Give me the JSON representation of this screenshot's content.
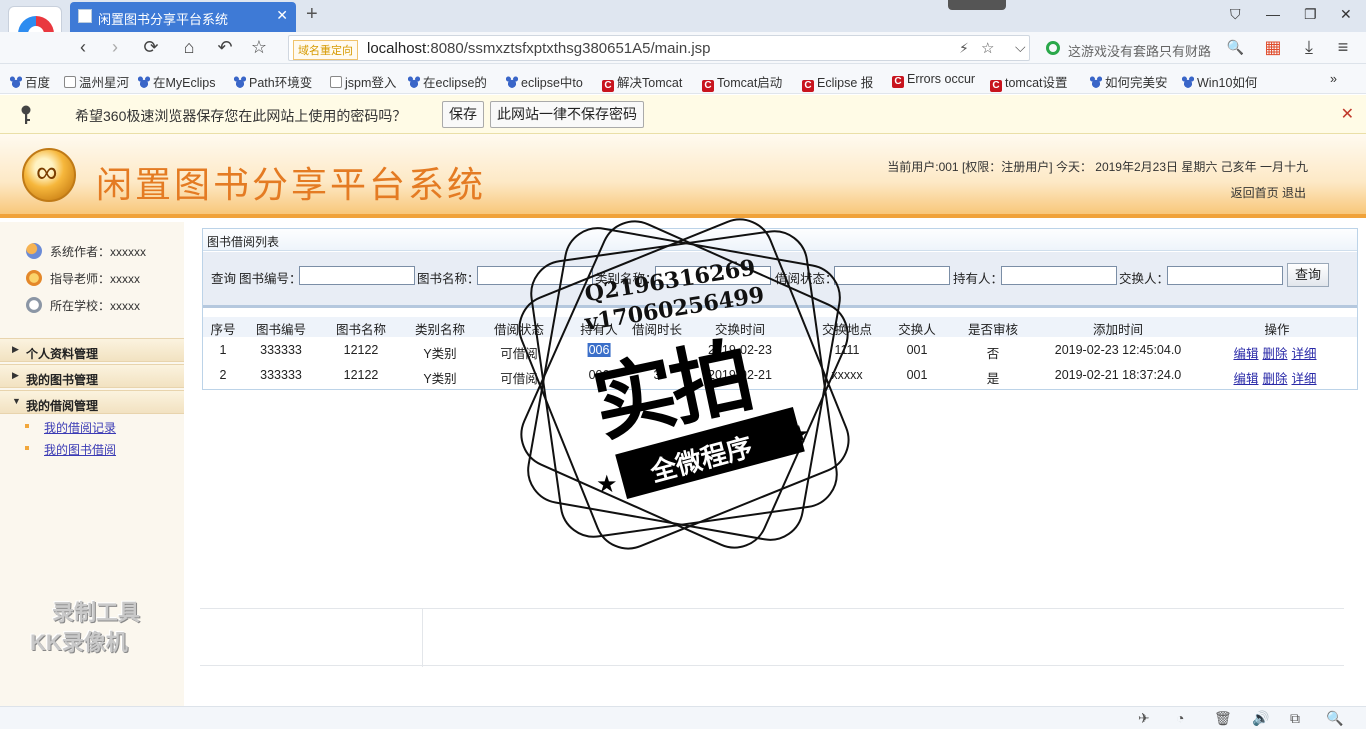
{
  "browser": {
    "tab_title": "闲置图书分享平台系统",
    "tab_close": "✕",
    "new_tab": "+",
    "window_controls": [
      "⛉",
      "—",
      "❐",
      "✕"
    ],
    "nav": {
      "back": "‹",
      "forward": "›",
      "reload": "⟳",
      "home": "⌂",
      "undo": "↶",
      "star": "☆"
    },
    "redirect_badge": "域名重定向",
    "url_host": "localhost",
    "url_rest": ":8080/ssmxztsfxptxthsg380651A5/main.jsp",
    "url_actions": [
      "⚡",
      "☆",
      "⌵"
    ],
    "search_text": "这游戏没有套路只有财路",
    "search_icon": "🔍",
    "right_icons": [
      "▦",
      "⤓",
      "≡"
    ],
    "bookmarks": [
      {
        "icon": "paw",
        "label": "百度"
      },
      {
        "icon": "doc",
        "label": "温州星河"
      },
      {
        "icon": "paw",
        "label": "在MyEclips"
      },
      {
        "icon": "paw",
        "label": "Path环境变"
      },
      {
        "icon": "doc",
        "label": "jspm登入"
      },
      {
        "icon": "paw",
        "label": "在eclipse的"
      },
      {
        "icon": "paw",
        "label": "eclipse中to"
      },
      {
        "icon": "c",
        "label": "解决Tomcat"
      },
      {
        "icon": "c",
        "label": "Tomcat启动"
      },
      {
        "icon": "c",
        "label": "Eclipse 报"
      },
      {
        "icon": "c",
        "label": "Errors occur"
      },
      {
        "icon": "c",
        "label": "tomcat设置"
      },
      {
        "icon": "paw",
        "label": "如何完美安"
      },
      {
        "icon": "paw",
        "label": "Win10如何"
      }
    ],
    "bookmarks_more": "»",
    "password_prompt": "希望360极速浏览器保存您在此网站上使用的密码吗？",
    "save_button": "保存",
    "never_button": "此网站一律不保存密码",
    "close_prompt": "✕"
  },
  "header": {
    "system_title": "闲置图书分享平台系统",
    "user_info": "当前用户:001 [权限：注册用户] 今天： 2019年2月23日 星期六 己亥年 一月十九",
    "home_link": "返回首页",
    "logout_link": "退出"
  },
  "sidebar": {
    "info": [
      {
        "label": "系统作者：xxxxxx"
      },
      {
        "label": "指导老师：xxxxx"
      },
      {
        "label": "所在学校：xxxxx"
      }
    ],
    "groups": [
      {
        "label": "个人资料管理"
      },
      {
        "label": "我的图书管理"
      },
      {
        "label": "我的借阅管理"
      }
    ],
    "sub_items": [
      {
        "label": "我的借阅记录"
      },
      {
        "label": "我的图书借阅"
      }
    ],
    "recorder_watermark": [
      "录制工具",
      "KK录像机"
    ]
  },
  "main": {
    "panel_title": "图书借阅列表",
    "search": {
      "query_label": "查询",
      "fields": [
        {
          "label": "图书编号：",
          "value": ""
        },
        {
          "label": "图书名称：",
          "value": ""
        },
        {
          "label": "类别名称：",
          "value": ""
        },
        {
          "label": "借阅状态：",
          "value": ""
        },
        {
          "label": "持有人：",
          "value": ""
        },
        {
          "label": "交换人：",
          "value": ""
        }
      ],
      "button": "查询"
    },
    "columns": [
      "序号",
      "图书编号",
      "图书名称",
      "类别名称",
      "借阅状态",
      "持有人",
      "借阅时长",
      "交换时间",
      "交换地点",
      "交换人",
      "是否审核",
      "添加时间",
      "操作"
    ],
    "rows": [
      {
        "no": "1",
        "code": "333333",
        "name": "12122",
        "category": "Y类别",
        "status": "可借阅",
        "holder": "006",
        "duration": "",
        "time": "2019-02-23",
        "place": "1111",
        "exchanger": "001",
        "audited": "否",
        "added": "2019-02-23 12:45:04.0"
      },
      {
        "no": "2",
        "code": "333333",
        "name": "12122",
        "category": "Y类别",
        "status": "可借阅",
        "holder": "006",
        "duration": "3",
        "time": "2019-02-21",
        "place": "xxxxx",
        "exchanger": "001",
        "audited": "是",
        "added": "2019-02-21 18:37:24.0"
      }
    ],
    "actions": [
      "编辑",
      "删除",
      "详细"
    ]
  },
  "stamp": {
    "qq": "Q2196316269",
    "vx": "v17060256499",
    "big": "实拍",
    "ribbon": "全微程序",
    "star": "★"
  },
  "statusbar": {
    "icons": [
      "✈",
      "◔",
      "🗑",
      "🔊",
      "⧉",
      "🔍"
    ]
  }
}
